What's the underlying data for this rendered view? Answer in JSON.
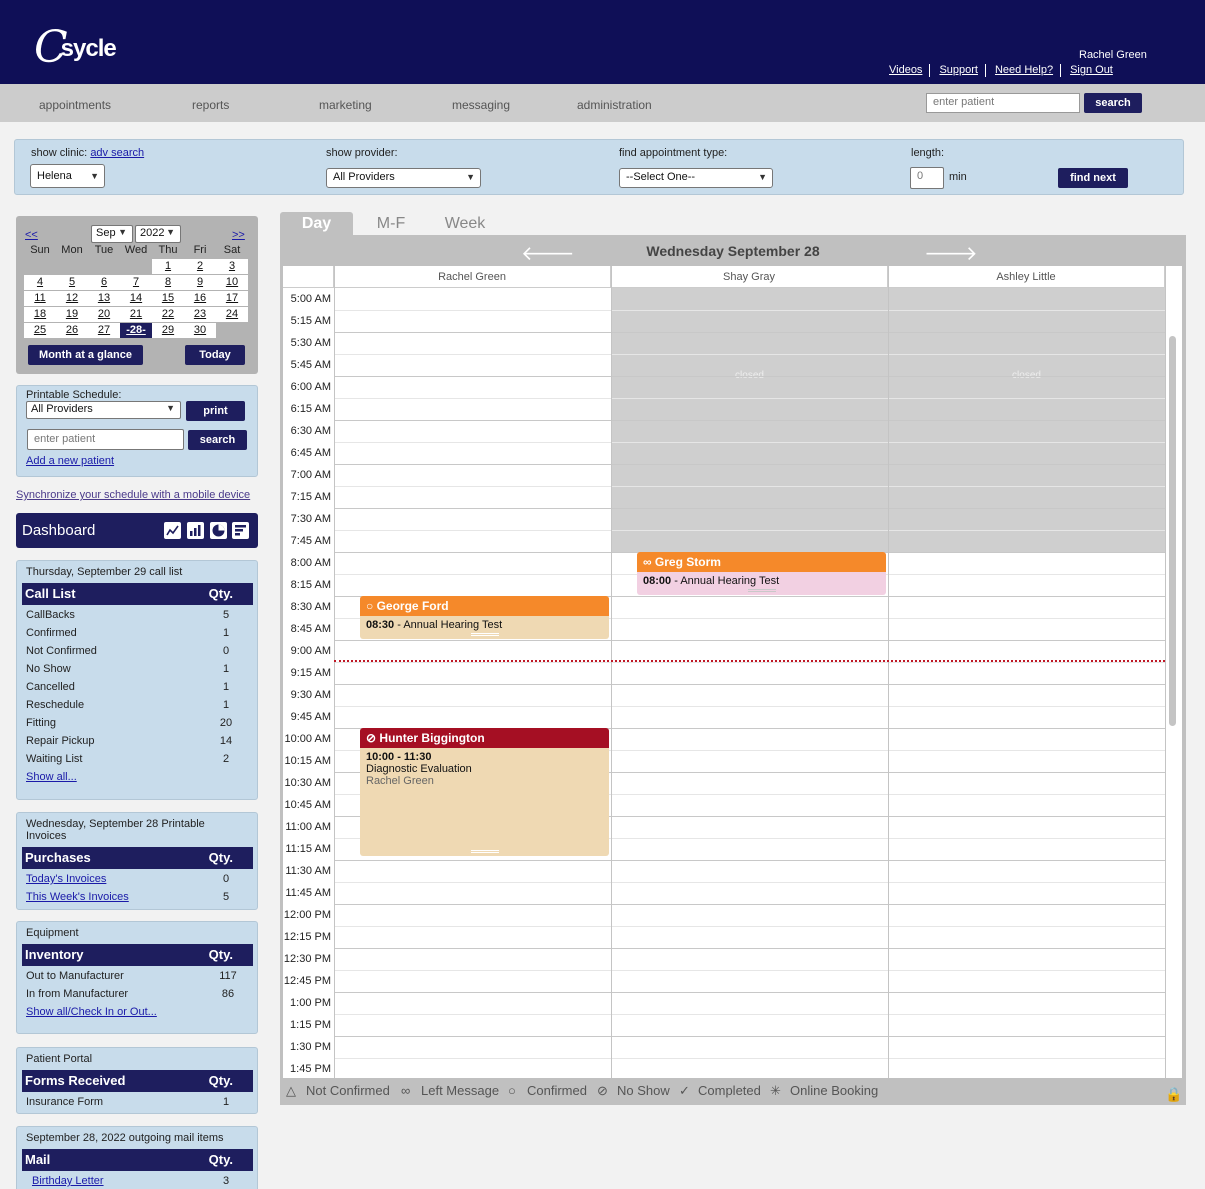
{
  "header": {
    "logo_initial": "C",
    "logo_rest": "sycle",
    "user_name": "Rachel Green",
    "links": [
      "Videos",
      "Support",
      "Need Help?",
      "Sign Out"
    ]
  },
  "nav": {
    "items": [
      "appointments",
      "reports",
      "marketing",
      "messaging",
      "administration"
    ],
    "search_placeholder": "enter patient",
    "search_label": "search"
  },
  "filters": {
    "clinic_label": "show clinic:",
    "adv_search": "adv search",
    "clinic_value": "Helena",
    "provider_label": "show provider:",
    "provider_value": "All Providers",
    "appt_type_label": "find appointment type:",
    "appt_type_value": "--Select One--",
    "length_label": "length:",
    "length_value": "0",
    "length_unit": "min",
    "find_next": "find next"
  },
  "mini_calendar": {
    "prev": "<<",
    "next": ">>",
    "month": "Sep",
    "year": "2022",
    "weekdays": [
      "Sun",
      "Mon",
      "Tue",
      "Wed",
      "Thu",
      "Fri",
      "Sat"
    ],
    "days": [
      "1",
      "2",
      "3",
      "4",
      "5",
      "6",
      "7",
      "8",
      "9",
      "10",
      "11",
      "12",
      "13",
      "14",
      "15",
      "16",
      "17",
      "18",
      "19",
      "20",
      "21",
      "22",
      "23",
      "24",
      "25",
      "26",
      "27",
      "-28-",
      "29",
      "30"
    ],
    "month_glance": "Month at a glance",
    "today": "Today"
  },
  "printable": {
    "label": "Printable Schedule:",
    "provider": "All Providers",
    "print": "print",
    "search_placeholder": "enter patient",
    "search": "search",
    "add_patient": "Add a new patient"
  },
  "sync_link": "Synchronize your schedule with a mobile device",
  "dashboard": {
    "title": "Dashboard"
  },
  "call_list": {
    "title": "Thursday, September 29 call list",
    "header": "Call List",
    "qty": "Qty.",
    "rows": [
      {
        "label": "CallBacks",
        "qty": "5"
      },
      {
        "label": "Confirmed",
        "qty": "1"
      },
      {
        "label": "Not Confirmed",
        "qty": "0"
      },
      {
        "label": "No Show",
        "qty": "1"
      },
      {
        "label": "Cancelled",
        "qty": "1"
      },
      {
        "label": "Reschedule",
        "qty": "1"
      },
      {
        "label": "Fitting",
        "qty": "20"
      },
      {
        "label": "Repair Pickup",
        "qty": "14"
      },
      {
        "label": "Waiting List",
        "qty": "2"
      }
    ],
    "show_all": "Show all..."
  },
  "invoices": {
    "title": "Wednesday, September 28 Printable Invoices",
    "header": "Purchases",
    "qty": "Qty.",
    "rows": [
      {
        "label": "Today's Invoices",
        "qty": "0"
      },
      {
        "label": "This Week's Invoices",
        "qty": "5"
      }
    ]
  },
  "equipment": {
    "title": "Equipment",
    "header": "Inventory",
    "qty": "Qty.",
    "rows": [
      {
        "label": "Out to Manufacturer",
        "qty": "117"
      },
      {
        "label": "In from Manufacturer",
        "qty": "86"
      }
    ],
    "show_all": "Show all/Check In or Out..."
  },
  "portal": {
    "title": "Patient Portal",
    "header": "Forms Received",
    "qty": "Qty.",
    "rows": [
      {
        "label": "Insurance Form",
        "qty": "1"
      }
    ]
  },
  "mail": {
    "title": "September 28, 2022 outgoing mail items",
    "header": "Mail",
    "qty": "Qty.",
    "rows": [
      {
        "label": "Birthday Letter",
        "qty": "3"
      }
    ]
  },
  "schedule": {
    "tabs": [
      "Day",
      "M-F",
      "Week"
    ],
    "date": "Wednesday September 28",
    "prev_icon": "arrow-left-icon",
    "next_icon": "arrow-right-icon",
    "providers": [
      "Rachel Green",
      "Shay Gray",
      "Ashley Little"
    ],
    "times": [
      "5:00 AM",
      "5:15 AM",
      "5:30 AM",
      "5:45 AM",
      "6:00 AM",
      "6:15 AM",
      "6:30 AM",
      "6:45 AM",
      "7:00 AM",
      "7:15 AM",
      "7:30 AM",
      "7:45 AM",
      "8:00 AM",
      "8:15 AM",
      "8:30 AM",
      "8:45 AM",
      "9:00 AM",
      "9:15 AM",
      "9:30 AM",
      "9:45 AM",
      "10:00 AM",
      "10:15 AM",
      "10:30 AM",
      "10:45 AM",
      "11:00 AM",
      "11:15 AM",
      "11:30 AM",
      "11:45 AM",
      "12:00 PM",
      "12:15 PM",
      "12:30 PM",
      "12:45 PM",
      "1:00 PM",
      "1:15 PM",
      "1:30 PM",
      "1:45 PM"
    ],
    "closed_label": "closed",
    "appointments": [
      {
        "patient": "Greg Storm",
        "time": "08:00",
        "type": "Annual Hearing Test",
        "status_icon": "left-message-icon",
        "color": "#f5892a",
        "body_color": "#f2d0e2"
      },
      {
        "patient": "George Ford",
        "time": "08:30",
        "type": "Annual Hearing Test",
        "status_icon": "confirmed-icon",
        "color": "#f5892a",
        "body_color": "#efd9b3"
      },
      {
        "patient": "Hunter Biggington",
        "time": "10:00 - 11:30",
        "type": "Diagnostic Evaluation",
        "provider": "Rachel Green",
        "status_icon": "no-show-icon",
        "color": "#a50f23",
        "body_color": "#efd9b3"
      }
    ]
  },
  "legend": [
    {
      "icon": "not-confirmed-icon",
      "glyph": "△",
      "label": "Not Confirmed"
    },
    {
      "icon": "left-message-icon",
      "glyph": "∞",
      "label": "Left Message"
    },
    {
      "icon": "confirmed-icon",
      "glyph": "○",
      "label": "Confirmed"
    },
    {
      "icon": "no-show-icon",
      "glyph": "⊘",
      "label": "No Show"
    },
    {
      "icon": "completed-icon",
      "glyph": "✓",
      "label": "Completed"
    },
    {
      "icon": "online-booking-icon",
      "glyph": "✳",
      "label": "Online Booking"
    }
  ]
}
